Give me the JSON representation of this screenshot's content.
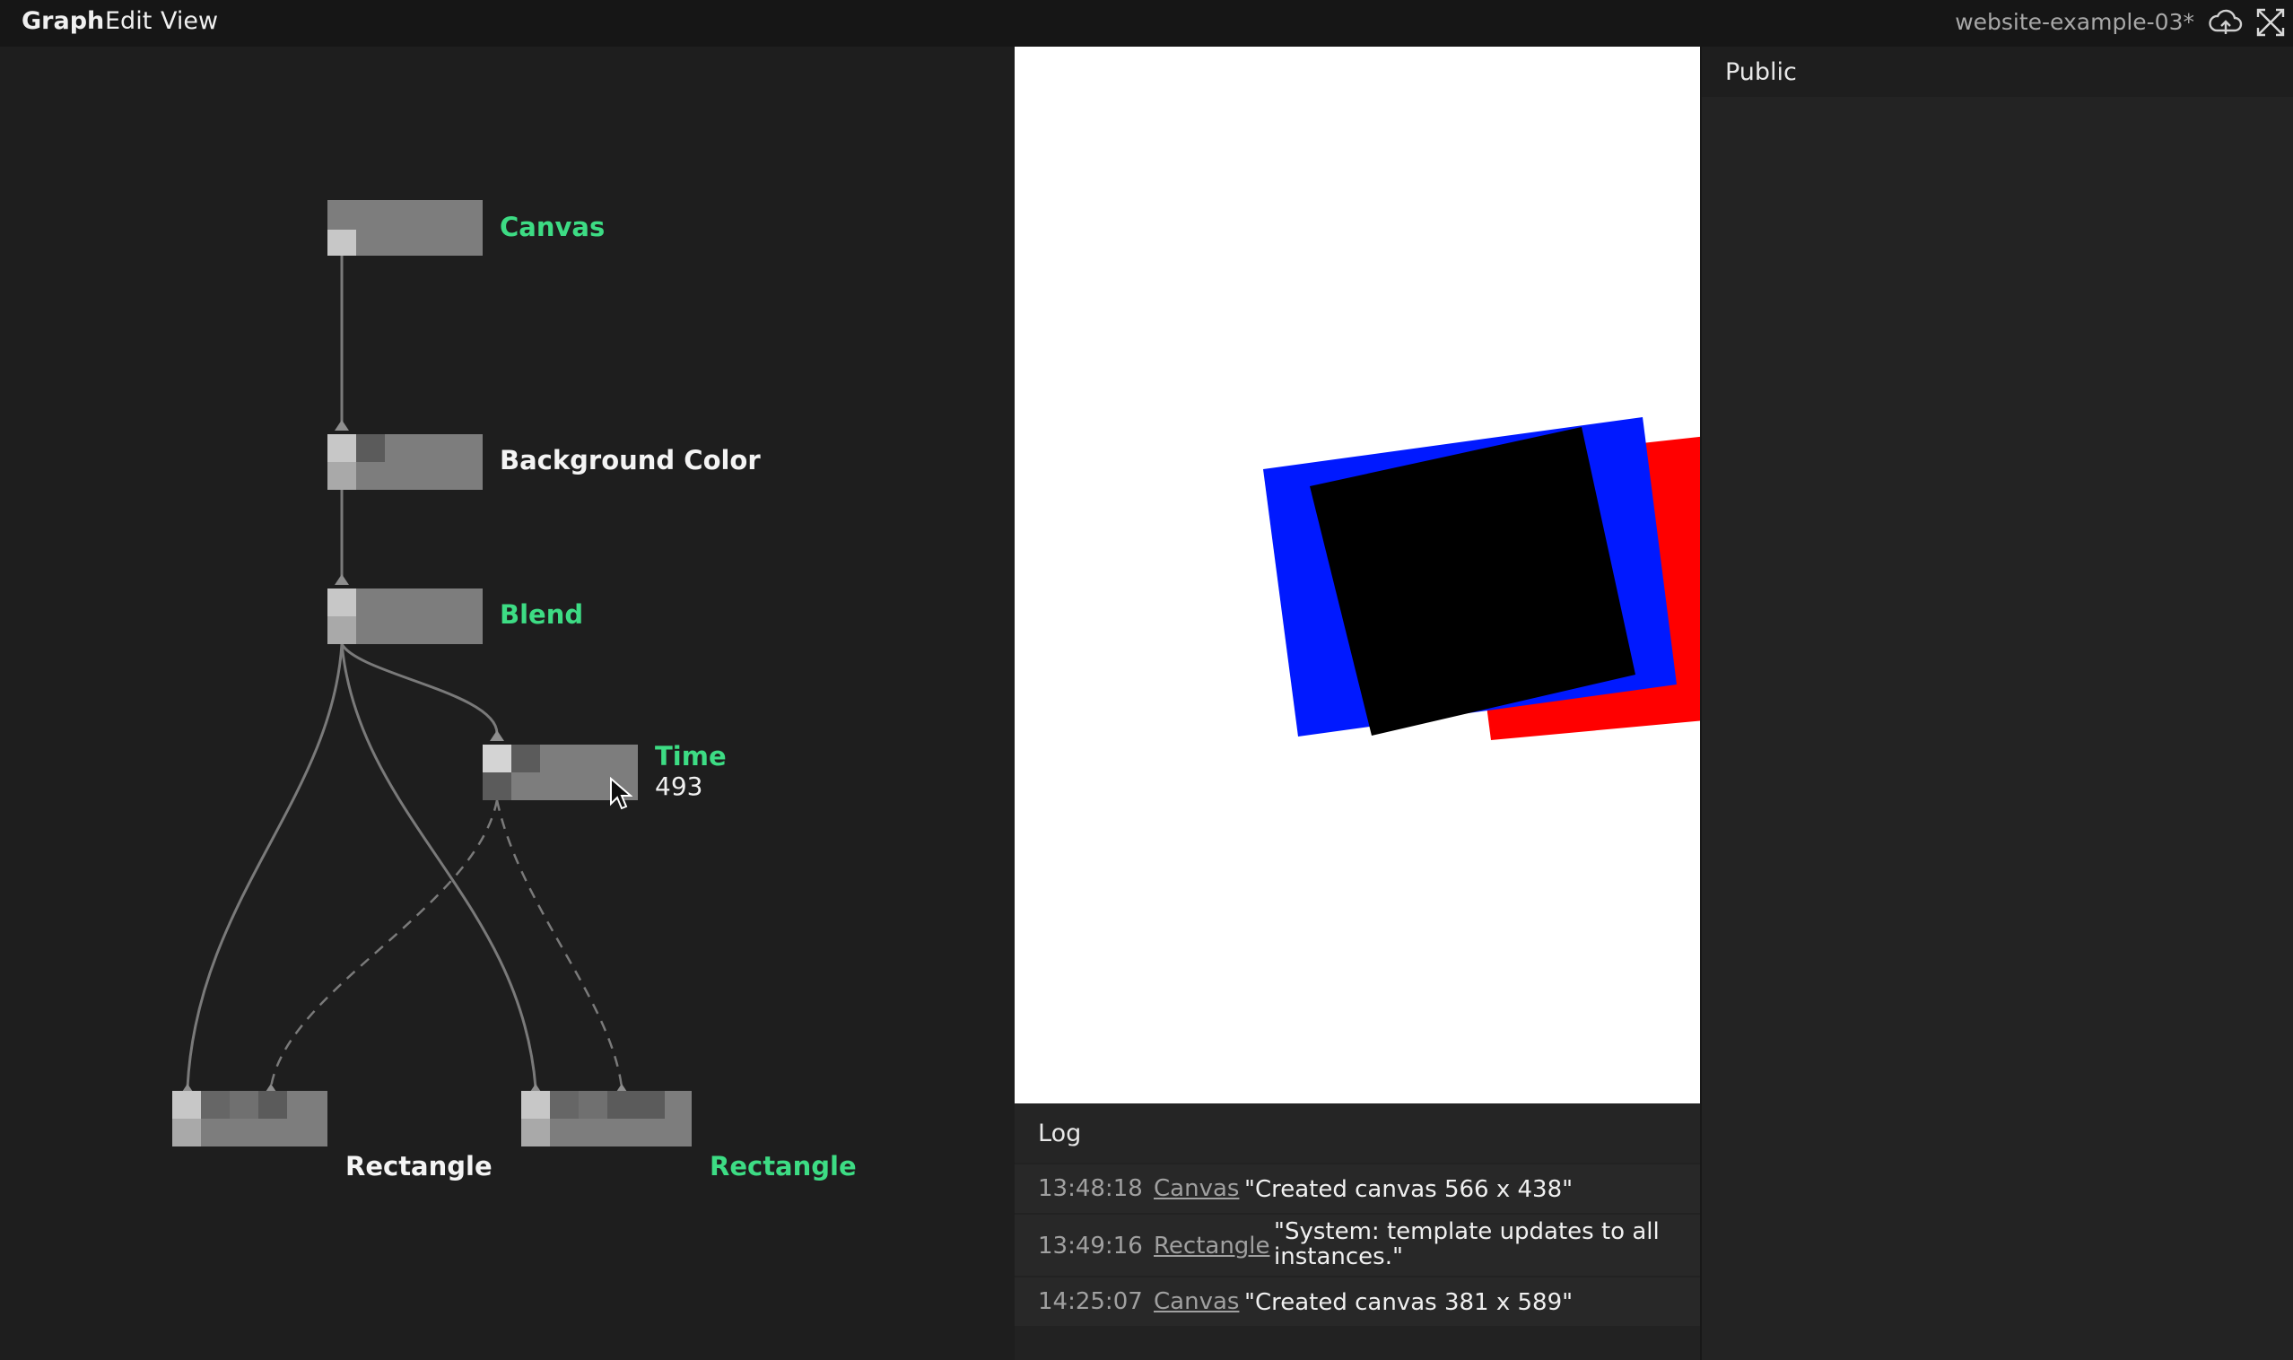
{
  "menu": {
    "graph": "Graph",
    "edit": "Edit",
    "view": "View"
  },
  "file_title": "website-example-03*",
  "icons": {
    "cloud": "cloud-upload-icon",
    "fullscreen": "fullscreen-icon",
    "cursor": "mouse-pointer-icon"
  },
  "colors": {
    "green_label": "#3ddc84",
    "rect_blue": "#0019ff",
    "rect_red": "#ff0000",
    "rect_black": "#000000"
  },
  "nodes": {
    "canvas": "Canvas",
    "background_color": "Background Color",
    "blend": "Blend",
    "time": "Time",
    "time_value": "493",
    "rectangle_1": "Rectangle",
    "rectangle_2": "Rectangle"
  },
  "log": {
    "title": "Log",
    "entries": [
      {
        "time": "13:48:18",
        "source": "Canvas",
        "message": "\"Created canvas 566 x 438\""
      },
      {
        "time": "13:49:16",
        "source": "Rectangle",
        "message_line1": "\"System: template updates to all",
        "message_line2": "instances.\""
      },
      {
        "time": "14:25:07",
        "source": "Canvas",
        "message": "\"Created canvas 381 x 589\""
      }
    ]
  },
  "params": {
    "title": "Public"
  }
}
